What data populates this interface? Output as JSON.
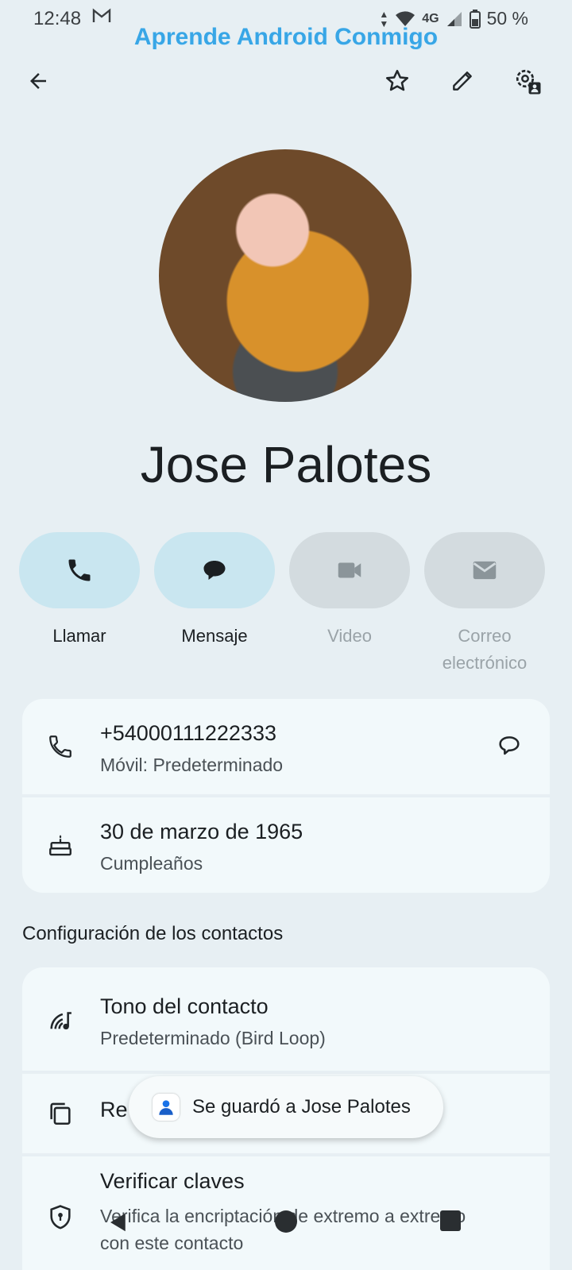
{
  "status_bar": {
    "time": "12:48",
    "network": "4G",
    "battery": "50 %"
  },
  "watermark": "Aprende Android Conmigo",
  "contact": {
    "name": "Jose Palotes"
  },
  "actions": [
    {
      "label": "Llamar",
      "enabled": true
    },
    {
      "label": "Mensaje",
      "enabled": true
    },
    {
      "label": "Video",
      "enabled": false
    },
    {
      "label": "Correo electrónico",
      "enabled": false
    }
  ],
  "details": {
    "phone": {
      "value": "+54000111222333",
      "type": "Móvil: Predeterminado"
    },
    "birthday": {
      "value": "30 de marzo de 1965",
      "type": "Cumpleaños"
    }
  },
  "settings": {
    "title": "Configuración de los contactos",
    "ringtone": {
      "title": "Tono del contacto",
      "value": "Predeterminado (Bird Loop)"
    },
    "redirect": {
      "title_partial": "Re"
    },
    "verify": {
      "title": "Verificar claves",
      "desc": "Verifica la encriptación de extremo a extremo con este contacto"
    }
  },
  "snackbar": {
    "text": "Se guardó a Jose Palotes"
  },
  "colors": {
    "accent_bg": "#c9e6f0",
    "disabled_bg": "#d3dbdf",
    "page_bg": "#e7eff3",
    "card_bg": "#f2f9fb",
    "watermark": "#38a6e6"
  }
}
